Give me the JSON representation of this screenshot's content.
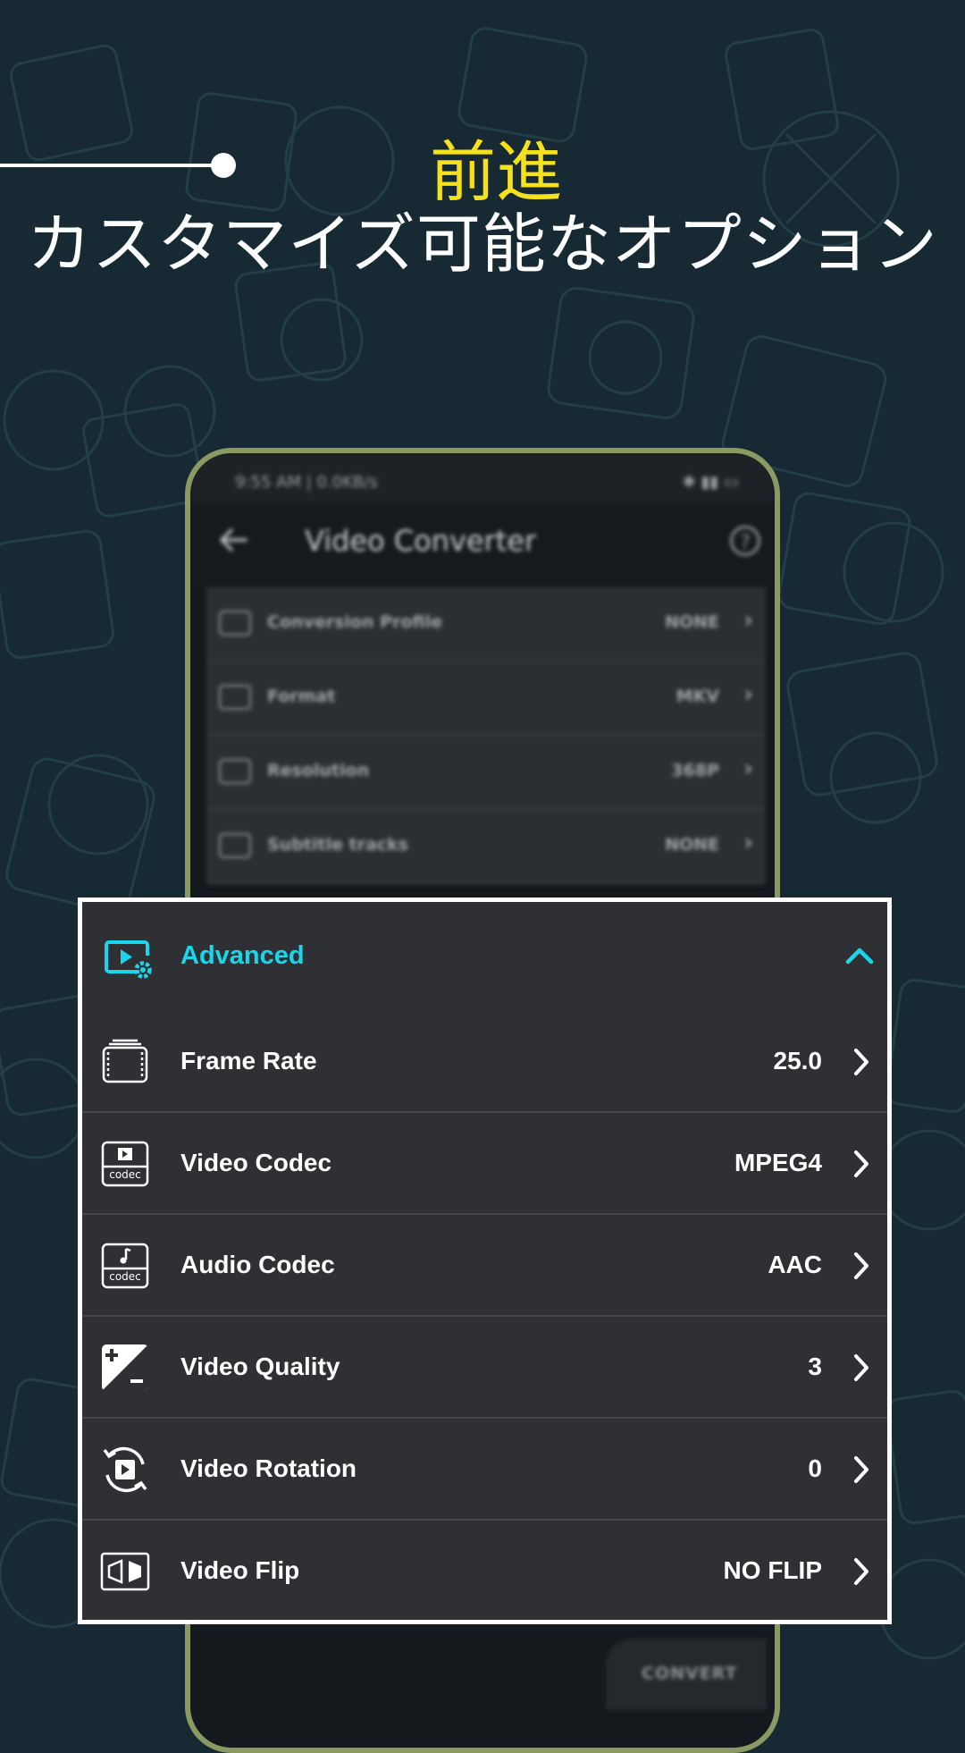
{
  "headline": {
    "accent": "前進",
    "main": "カスタマイズ可能なオプション"
  },
  "colors": {
    "background": "#172a33",
    "accent_yellow": "#f5e11c",
    "accent_cyan": "#19d6ea",
    "card_background": "#2e3034",
    "phone_frame": "#8b9a62"
  },
  "phone": {
    "status_bar": {
      "time": "9:55 AM | 0.0KB/s",
      "icons": "✱ ▮▮ ▭"
    },
    "app_bar": {
      "back_icon": "arrow-left-icon",
      "title": "Video Converter",
      "help_icon": "help-circle-icon",
      "help_glyph": "?"
    },
    "settings": [
      {
        "icon": "profile-icon",
        "label": "Conversion Profile",
        "value": "NONE"
      },
      {
        "icon": "format-icon",
        "label": "Format",
        "value": "MKV"
      },
      {
        "icon": "resolution-icon",
        "label": "Resolution",
        "value": "368P"
      },
      {
        "icon": "subtitle-icon",
        "label": "Subtitle tracks",
        "value": "NONE"
      }
    ],
    "chevron_glyph": "›",
    "convert_label": "CONVERT"
  },
  "advanced": {
    "icon": "video-settings-icon",
    "label": "Advanced",
    "toggle_icon": "chevron-up-icon",
    "items": [
      {
        "icon": "frame-rate-icon",
        "label": "Frame Rate",
        "value": "25.0"
      },
      {
        "icon": "video-codec-icon",
        "label": "Video Codec",
        "value": "MPEG4",
        "icon_text": "codec"
      },
      {
        "icon": "audio-codec-icon",
        "label": "Audio Codec",
        "value": "AAC",
        "icon_text": "codec"
      },
      {
        "icon": "quality-icon",
        "label": "Video Quality",
        "value": "3"
      },
      {
        "icon": "rotation-icon",
        "label": "Video Rotation",
        "value": "0"
      },
      {
        "icon": "flip-icon",
        "label": "Video Flip",
        "value": "NO FLIP"
      }
    ]
  }
}
